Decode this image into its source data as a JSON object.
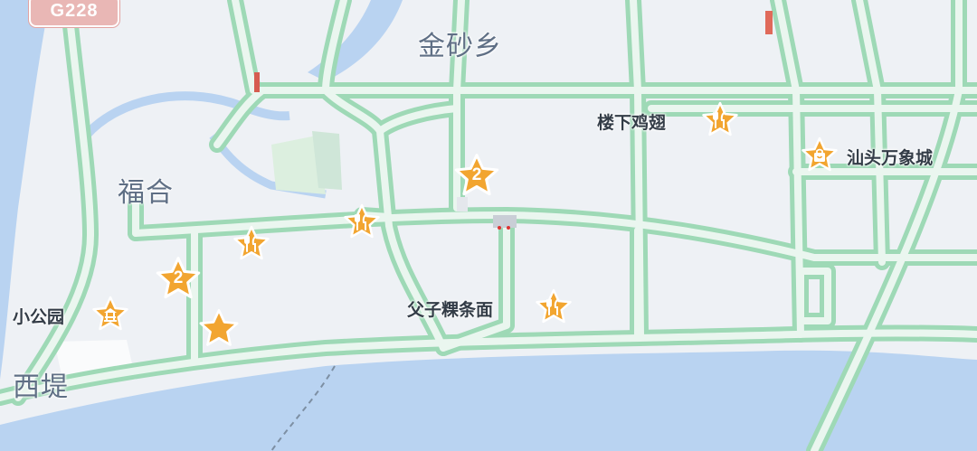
{
  "map": {
    "highway_shield": "G228",
    "places": [
      {
        "id": "jinsha",
        "text": "金砂乡"
      },
      {
        "id": "fuhe",
        "text": "福合"
      },
      {
        "id": "xidi",
        "text": "西堤"
      }
    ],
    "pois": [
      {
        "id": "louxia",
        "text": "楼下鸡翅",
        "icon": "fork-knife-icon"
      },
      {
        "id": "wanxiang",
        "text": "汕头万象城",
        "icon": "shopping-bag-icon"
      },
      {
        "id": "fuzi",
        "text": "父子粿条面",
        "icon": "fork-knife-icon"
      },
      {
        "id": "park",
        "text": "小公园",
        "icon": "pavilion-icon"
      }
    ],
    "clusters": [
      {
        "id": "c1",
        "count": "2"
      },
      {
        "id": "c2",
        "count": "2"
      }
    ],
    "colors": {
      "background": "#eef1f5",
      "water": "#b9d3f1",
      "green": "#dcefdf",
      "road_edge": "#9ed9b6",
      "marker": "#f2a530",
      "shield": "#e9b7b5"
    }
  }
}
